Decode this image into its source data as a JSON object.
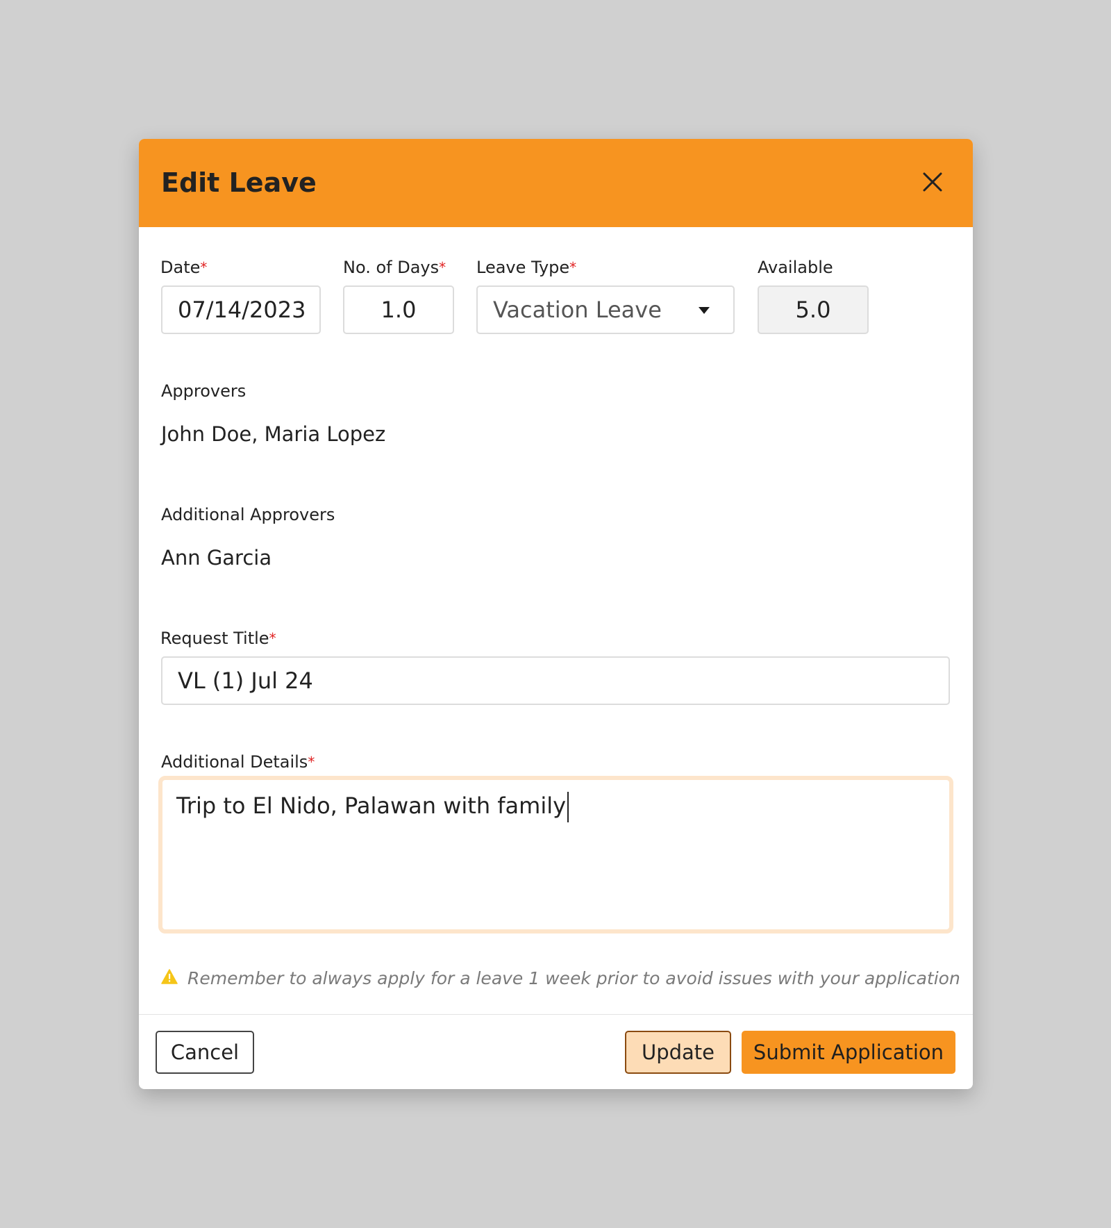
{
  "dialog": {
    "title": "Edit Leave",
    "close_icon": "close-icon"
  },
  "fields": {
    "date": {
      "label": "Date",
      "required_mark": "*",
      "value": "07/14/2023"
    },
    "days": {
      "label": "No. of Days",
      "required_mark": "*",
      "value": "1.0"
    },
    "leave_type": {
      "label": "Leave Type",
      "required_mark": "*",
      "value": "Vacation Leave",
      "icon": "caret-down-icon"
    },
    "available": {
      "label": "Available",
      "value": "5.0"
    },
    "approvers": {
      "label": "Approvers",
      "value": "John Doe, Maria Lopez"
    },
    "additional_approvers": {
      "label": "Additional Approvers",
      "value": "Ann Garcia"
    },
    "request_title": {
      "label": "Request Title",
      "required_mark": "*",
      "value": "VL (1) Jul 24"
    },
    "additional_details": {
      "label": "Additional Details",
      "required_mark": "*",
      "value": "Trip to El Nido, Palawan with family"
    }
  },
  "notice": {
    "icon": "warning-icon",
    "text": "Remember to always apply for a leave 1 week prior to avoid issues with your application"
  },
  "footer": {
    "cancel_label": "Cancel",
    "update_label": "Update",
    "submit_label": "Submit Application"
  },
  "colors": {
    "accent": "#f79420",
    "required": "#e02424",
    "focus_border": "#fde5cb",
    "update_bg": "#fddcb6",
    "warning": "#f5c518"
  }
}
